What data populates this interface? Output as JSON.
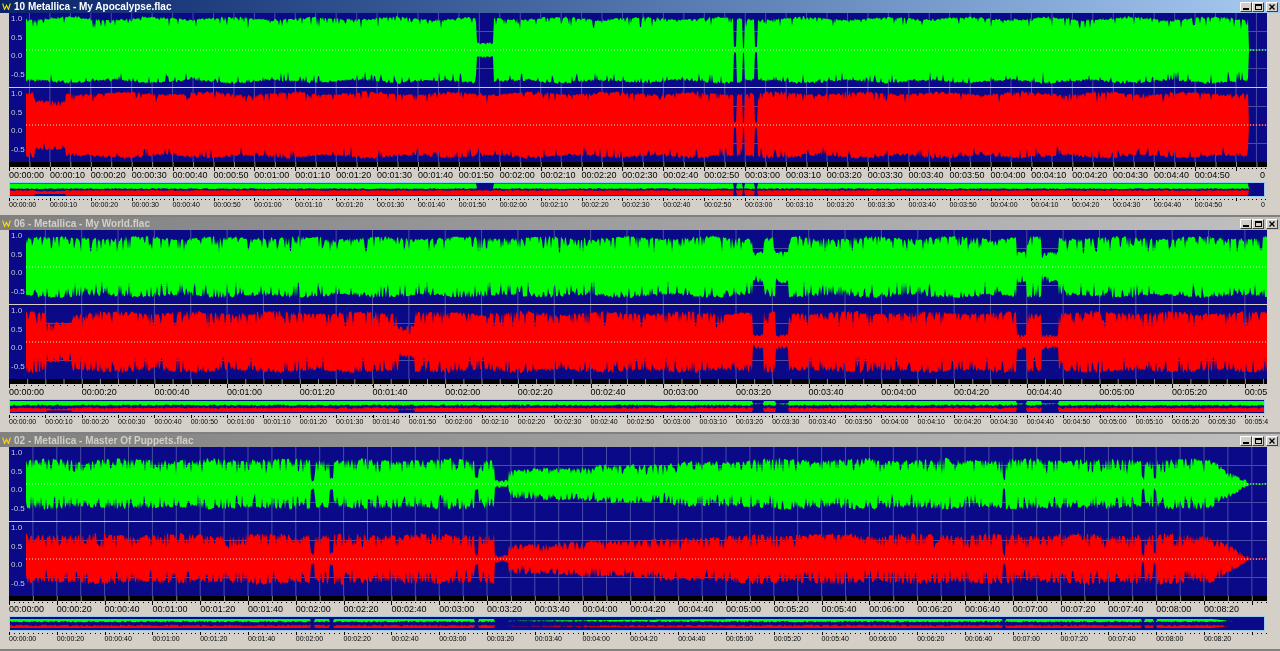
{
  "windows": [
    {
      "title": "10 Metallica - My Apocalypse.flac",
      "active": true,
      "channels": [
        {
          "color": "#00ff00",
          "scale_labels": [
            "1.0",
            "0.5",
            "0.0",
            "-0.5"
          ]
        },
        {
          "color": "#ff0000",
          "scale_labels": [
            "1.0",
            "0.5",
            "0.0",
            "-0.5"
          ]
        }
      ],
      "ruler": {
        "labels": [
          "00:00:00",
          "00:00:10",
          "00:00:20",
          "00:00:30",
          "00:00:40",
          "00:00:50",
          "00:01:00",
          "00:01:10",
          "00:01:20",
          "00:01:30",
          "00:01:40",
          "00:01:50",
          "00:02:00",
          "00:02:10",
          "00:02:20",
          "00:02:30",
          "00:02:40",
          "00:02:50",
          "00:03:00",
          "00:03:10",
          "00:03:20",
          "00:03:30",
          "00:03:40",
          "00:03:50",
          "00:04:00",
          "00:04:10",
          "00:04:20",
          "00:04:30",
          "00:04:40",
          "00:04:50"
        ],
        "end_label": "0"
      },
      "overview_ruler": {
        "labels": [
          "00:00:00",
          "00:00:10",
          "00:00:20",
          "00:00:30",
          "00:00:40",
          "00:00:50",
          "00:01:00",
          "00:01:10",
          "00:01:20",
          "00:01:30",
          "00:01:40",
          "00:01:50",
          "00:02:00",
          "00:02:10",
          "00:02:20",
          "00:02:30",
          "00:02:40",
          "00:02:50",
          "00:03:00",
          "00:03:10",
          "00:03:20",
          "00:03:30",
          "00:03:40",
          "00:03:50",
          "00:04:00",
          "00:04:10",
          "00:04:20",
          "00:04:30",
          "00:04:40",
          "00:04:50"
        ],
        "end_label": "0"
      }
    },
    {
      "title": "06 - Metallica - My World.flac",
      "active": false,
      "channels": [
        {
          "color": "#00ff00",
          "scale_labels": [
            "1.0",
            "0.5",
            "0.0",
            "-0.5"
          ]
        },
        {
          "color": "#ff0000",
          "scale_labels": [
            "1.0",
            "0.5",
            "0.0",
            "-0.5"
          ]
        }
      ],
      "ruler": {
        "labels": [
          "00:00:00",
          "00:00:20",
          "00:00:40",
          "00:01:00",
          "00:01:20",
          "00:01:40",
          "00:02:00",
          "00:02:20",
          "00:02:40",
          "00:03:00",
          "00:03:20",
          "00:03:40",
          "00:04:00",
          "00:04:20",
          "00:04:40",
          "00:05:00",
          "00:05:20",
          "00:05"
        ]
      },
      "overview_ruler": {
        "labels": [
          "00:00:00",
          "00:00:10",
          "00:00:20",
          "00:00:30",
          "00:00:40",
          "00:00:50",
          "00:01:00",
          "00:01:10",
          "00:01:20",
          "00:01:30",
          "00:01:40",
          "00:01:50",
          "00:02:00",
          "00:02:10",
          "00:02:20",
          "00:02:30",
          "00:02:40",
          "00:02:50",
          "00:03:00",
          "00:03:10",
          "00:03:20",
          "00:03:30",
          "00:03:40",
          "00:03:50",
          "00:04:00",
          "00:04:10",
          "00:04:20",
          "00:04:30",
          "00:04:40",
          "00:04:50",
          "00:05:00",
          "00:05:10",
          "00:05:20",
          "00:05:30",
          "00:05:4"
        ]
      }
    },
    {
      "title": "02 - Metallica - Master Of Puppets.flac",
      "active": false,
      "channels": [
        {
          "color": "#00ff00",
          "scale_labels": [
            "1.0",
            "0.5",
            "0.0",
            "-0.5"
          ]
        },
        {
          "color": "#ff0000",
          "scale_labels": [
            "1.0",
            "0.5",
            "0.0",
            "-0.5"
          ]
        }
      ],
      "ruler": {
        "labels": [
          "00:00:00",
          "00:00:20",
          "00:00:40",
          "00:01:00",
          "00:01:20",
          "00:01:40",
          "00:02:00",
          "00:02:20",
          "00:02:40",
          "00:03:00",
          "00:03:20",
          "00:03:40",
          "00:04:00",
          "00:04:20",
          "00:04:40",
          "00:05:00",
          "00:05:20",
          "00:05:40",
          "00:06:00",
          "00:06:20",
          "00:06:40",
          "00:07:00",
          "00:07:20",
          "00:07:40",
          "00:08:00",
          "00:08:20"
        ]
      },
      "overview_ruler": {
        "labels": [
          "00:00:00",
          "00:00:20",
          "00:00:40",
          "00:01:00",
          "00:01:20",
          "00:01:40",
          "00:02:00",
          "00:02:20",
          "00:02:40",
          "00:03:00",
          "00:03:20",
          "00:03:40",
          "00:04:00",
          "00:04:20",
          "00:04:40",
          "00:05:00",
          "00:05:20",
          "00:05:40",
          "00:06:00",
          "00:06:20",
          "00:06:40",
          "00:07:00",
          "00:07:20",
          "00:07:40",
          "00:08:00",
          "00:08:20"
        ]
      }
    }
  ]
}
